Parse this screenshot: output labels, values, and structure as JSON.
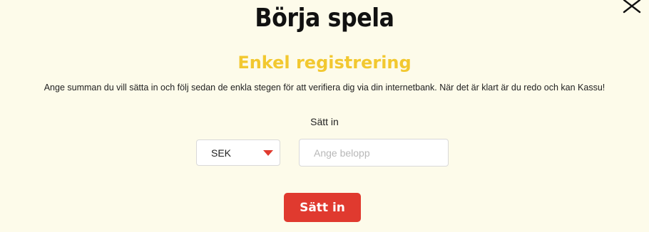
{
  "modal": {
    "title": "Börja spela",
    "subtitle": "Enkel registrering",
    "description": "Ange summan du vill sätta in och följ sedan de enkla stegen för att verifiera dig via din internetbank. När det är klart är du redo och kan Kassu!",
    "close_icon": "close-icon"
  },
  "deposit": {
    "label": "Sätt in",
    "currency": "SEK",
    "amount_value": "",
    "amount_placeholder": "Ange belopp",
    "button_label": "Sätt in"
  },
  "colors": {
    "background": "#fdfbea",
    "accent_yellow": "#f2c830",
    "accent_red": "#e03a2f"
  }
}
